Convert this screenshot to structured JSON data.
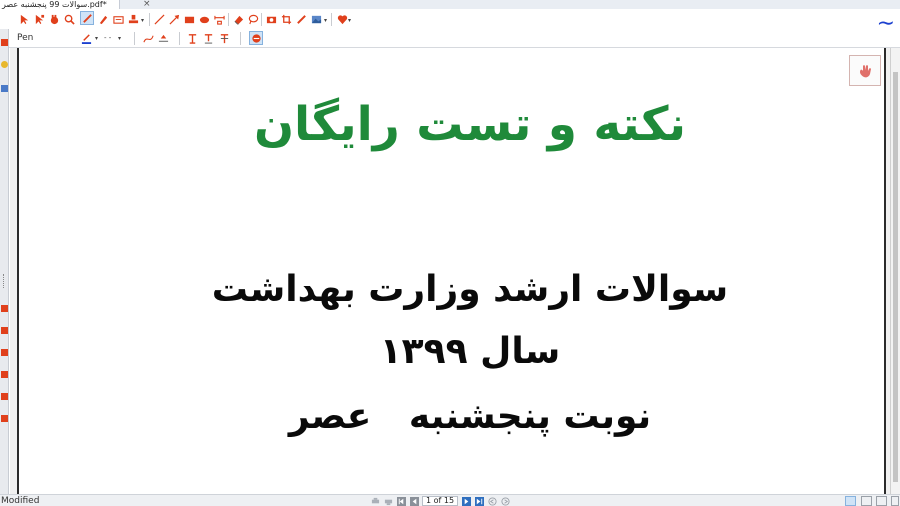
{
  "tab": {
    "title": "سوالات 99 پنجشنبه عصر.pdf*",
    "close": "×"
  },
  "toolbar": {
    "pen_label": "Pen",
    "dropdown_glyph": "▾",
    "dash_glyph": "- -",
    "colors": {
      "accent": "#e0401c",
      "active_bg": "#cfe3f7",
      "wave": "#1a3fcf",
      "pen_underline": "#1a3fcf"
    },
    "icons": [
      "select-icon",
      "select-annotation-icon",
      "hand-icon",
      "zoom-icon",
      "pen-icon",
      "highlighter-icon",
      "text-box-icon",
      "stamp-icon",
      "line-icon",
      "arrow-icon",
      "rectangle-icon",
      "ellipse-icon",
      "measure-icon",
      "eraser-icon",
      "lasso-icon",
      "camera-icon",
      "crop-icon",
      "pencil-icon",
      "image-icon",
      "favorite-icon",
      "wave-icon"
    ]
  },
  "document": {
    "title": "نکته و تست رایگان",
    "line1": "سوالات ارشد وزارت بهداشت",
    "line2": "سال ۱۳۹۹",
    "line3": "نوبت پنجشنبه   عصر",
    "title_color": "#1f8a3a",
    "text_color": "#0a0a0a"
  },
  "status": {
    "state": "Modified",
    "page_indicator": "1 of 15"
  }
}
